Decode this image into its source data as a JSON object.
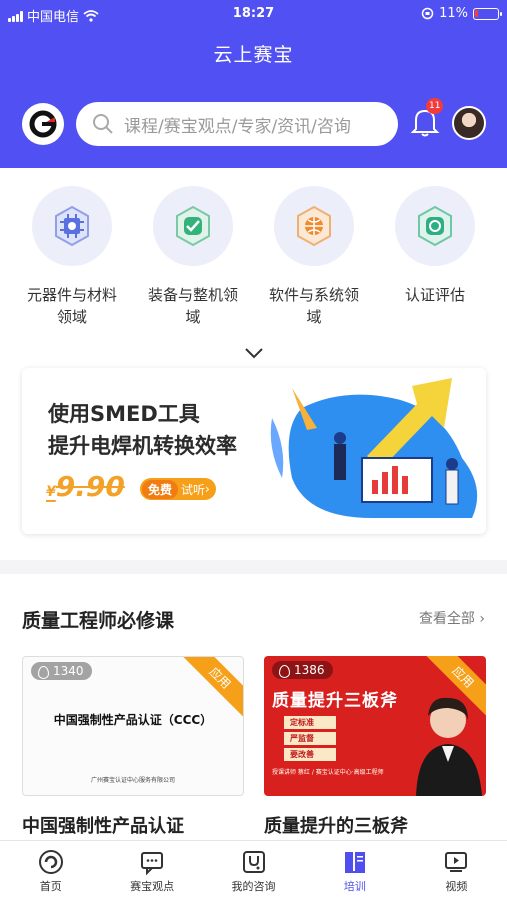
{
  "status_bar": {
    "carrier": "中国电信",
    "time": "18:27",
    "battery": "11%",
    "battery_level": 0.11
  },
  "header": {
    "title": "云上赛宝",
    "search_placeholder": "课程/赛宝观点/专家/资讯/咨询",
    "notification_count": "11",
    "accent": "#5150f2"
  },
  "categories": [
    {
      "label": "元器件与材料领域",
      "icon": "chip-icon"
    },
    {
      "label": "装备与整机领域",
      "icon": "check-shield-icon"
    },
    {
      "label": "软件与系统领域",
      "icon": "globe-icon"
    },
    {
      "label": "认证评估",
      "icon": "certificate-icon"
    }
  ],
  "banner": {
    "line1": "使用SMED工具",
    "line2": "提升电焊机转换效率",
    "currency": "¥",
    "price": "9.90",
    "free": "免费",
    "trial": "试听"
  },
  "section": {
    "title": "质量工程师必修课",
    "more": "查看全部"
  },
  "courses": [
    {
      "views": "1340",
      "tag": "应用",
      "cover_title": "中国强制性产品认证（CCC）",
      "cover_sub": "广州赛宝认证中心服务有限公司",
      "name": "中国强制性产品认证"
    },
    {
      "views": "1386",
      "tag": "应用",
      "cover_title": "质量提升三板斧",
      "cover_bullets": [
        "定标准",
        "严监督",
        "要改善"
      ],
      "cover_foot": "授课讲师  蔡红 / 赛宝认证中心·高级工程师",
      "name": "质量提升的三板斧"
    }
  ],
  "bottom_nav": [
    {
      "label": "首页",
      "icon": "home-icon"
    },
    {
      "label": "赛宝观点",
      "icon": "chat-icon"
    },
    {
      "label": "我的咨询",
      "icon": "stethoscope-icon"
    },
    {
      "label": "培训",
      "icon": "book-icon",
      "active": true
    },
    {
      "label": "视频",
      "icon": "video-icon"
    }
  ]
}
